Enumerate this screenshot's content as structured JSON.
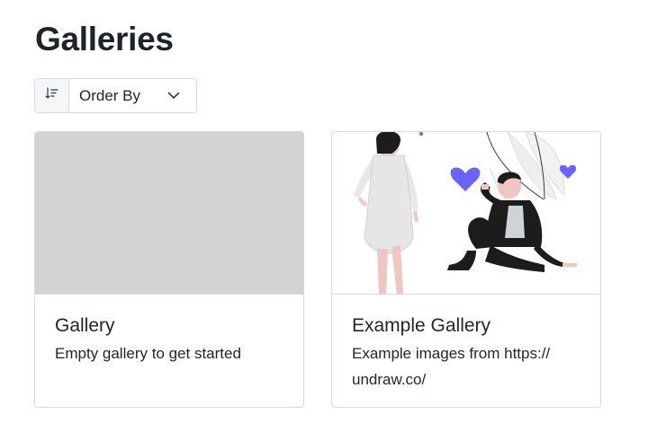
{
  "page": {
    "title": "Galleries"
  },
  "toolbar": {
    "sort_icon": "sort-descending-icon",
    "order_label": "Order By",
    "chevron_icon": "chevron-down-icon"
  },
  "galleries": [
    {
      "title": "Gallery",
      "description": "Empty gallery to get started",
      "image": "placeholder"
    },
    {
      "title": "Example Gallery",
      "description": "Example images from https:// undraw.co/",
      "image": "undraw-illustration"
    }
  ],
  "colors": {
    "accent": "#6c63ff",
    "placeholder": "#d1d3d5",
    "border": "#d6d9dd"
  }
}
